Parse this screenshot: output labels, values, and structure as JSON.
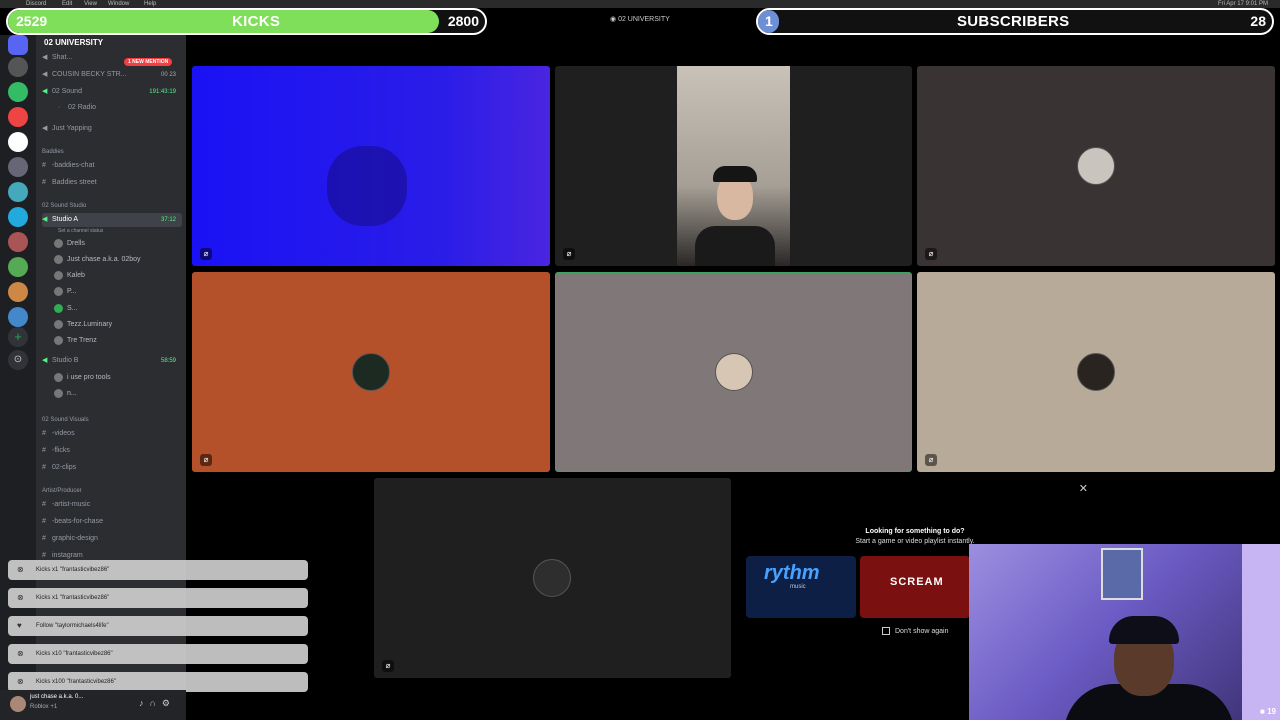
{
  "menubar": {
    "app": "Discord",
    "items": [
      "Edit",
      "View",
      "Window",
      "Help"
    ],
    "clock": "Fri Apr 17 9:01 PM"
  },
  "overlay": {
    "kicks": {
      "current": "2529",
      "label": "KICKS",
      "goal": "2800",
      "progress": 0.903
    },
    "subs": {
      "current": "1",
      "label": "SUBSCRIBERS",
      "goal": "28",
      "progress": 0.036
    },
    "server_name_top": "02 UNIVERSITY"
  },
  "sidebar": {
    "server_title": "02 UNIVERSITY",
    "mention_badge": "1 NEW MENTION",
    "voice_top": [
      {
        "name": "Shat...",
        "icon": "speaker-icon"
      },
      {
        "name": "COUSIN BECKY STR...",
        "right": "00 23"
      },
      {
        "name": "02 Sound",
        "right": "191:43:19"
      },
      {
        "name": "02 Radio",
        "sub": true
      },
      {
        "name": "Just Yapping"
      }
    ],
    "cat_baddies": "Baddies",
    "baddies": [
      "-baddies-chat",
      "Baddies street"
    ],
    "cat_studio": "02 Sound Studio",
    "studio_a": {
      "name": "Studio A",
      "timer": "37:12",
      "status": "Set a channel status"
    },
    "studio_a_users": [
      "Drells",
      "Just chase a.k.a. 02boy",
      "Kaleb",
      "P...",
      "S...",
      "Tezz.Luminary",
      "Tre Trenz"
    ],
    "studio_b": {
      "name": "Studio B",
      "timer": "58:59"
    },
    "studio_b_users": [
      "i use pro tools",
      "n..."
    ],
    "cat_visuals": "02 Sound Visuals",
    "visuals": [
      "-videos",
      "-flicks",
      "02-clips"
    ],
    "cat_artist": "Artist/Producer",
    "artist": [
      "-artist-music",
      "-beats-for-chase",
      "graphic-design",
      "instagram"
    ]
  },
  "toasts": [
    {
      "icon": "kick-icon",
      "text": "Kicks x1 \"frantasticvibez86\""
    },
    {
      "icon": "kick-icon",
      "text": "Kicks x1 \"frantasticvibez86\""
    },
    {
      "icon": "heart-icon",
      "text": "Follow \"taylormichaels4life\""
    },
    {
      "icon": "kick-icon",
      "text": "Kicks x10 \"frantasticvibez86\""
    },
    {
      "icon": "kick-icon",
      "text": "Kicks x100 \"frantasticvibez86\""
    }
  ],
  "user_panel": {
    "name": "just chase a.k.a. 0...",
    "status": "Roblox +1"
  },
  "tiles": [
    {
      "name": "tile-blue-camera",
      "bg": "#1a10f0"
    },
    {
      "name": "tile-camera-person",
      "bg": "#1f1f1f"
    },
    {
      "name": "tile-avatar-1",
      "bg": "#3a3333"
    },
    {
      "name": "tile-avatar-2",
      "bg": "#b5512a"
    },
    {
      "name": "tile-avatar-3",
      "bg": "#807878"
    },
    {
      "name": "tile-avatar-4",
      "bg": "#b8aa98"
    },
    {
      "name": "tile-avatar-5",
      "bg": "#1f1f1f"
    }
  ],
  "activity": {
    "title": "Looking for something to do?",
    "subtitle": "Start a game or video playlist instantly.",
    "card1": "rythm",
    "card1_sub": "music",
    "card2": "SCREAM",
    "dont_show": "Don't show again"
  },
  "webcam": {
    "viewers": "19"
  }
}
